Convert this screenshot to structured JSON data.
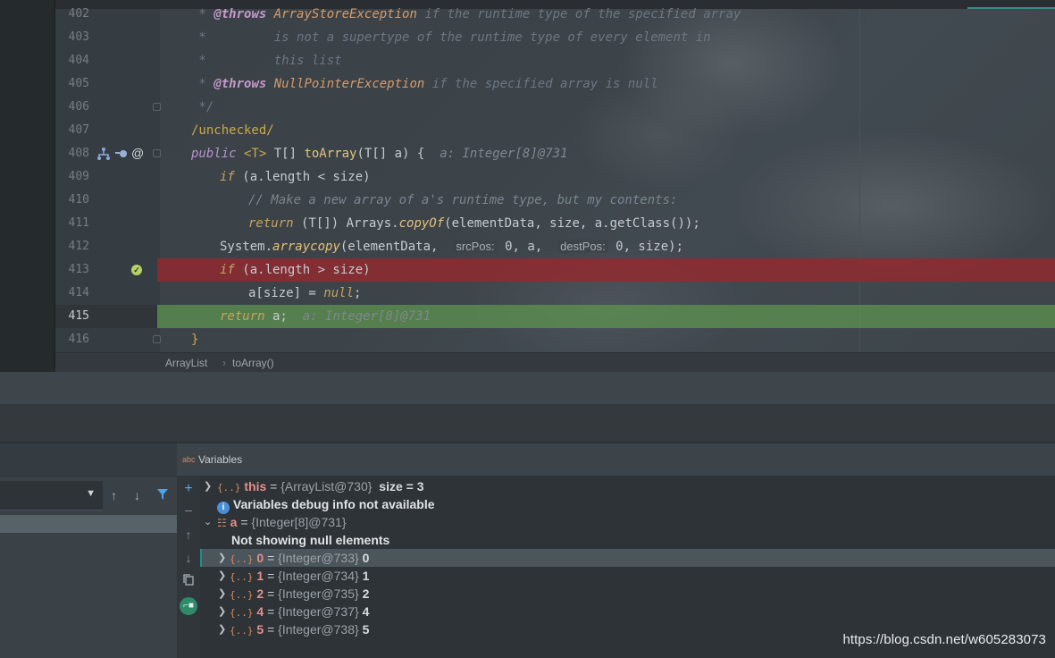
{
  "editor": {
    "lines": [
      {
        "num": "402"
      },
      {
        "num": "403"
      },
      {
        "num": "404"
      },
      {
        "num": "405"
      },
      {
        "num": "406"
      },
      {
        "num": "407"
      },
      {
        "num": "408"
      },
      {
        "num": "409"
      },
      {
        "num": "410"
      },
      {
        "num": "411"
      },
      {
        "num": "412"
      },
      {
        "num": "413"
      },
      {
        "num": "414"
      },
      {
        "num": "415"
      },
      {
        "num": "416"
      }
    ],
    "code": {
      "l402_star": " * ",
      "l402_tag": "@throws",
      "l402_exc": "ArrayStoreException",
      "l402_text": " if the runtime type of the specified array",
      "l403_text": " *         is not a supertype of the runtime type of every element in",
      "l404_text": " *         this list",
      "l405_star": " * ",
      "l405_tag": "@throws",
      "l405_exc": "NullPointerException",
      "l405_text": " if the specified array is null",
      "l406_text": " */",
      "l407_text": "/unchecked/",
      "l408_public": "public",
      "l408_generic": " <T> ",
      "l408_ret": "T[] ",
      "l408_fn": "toArray",
      "l408_sig": "(T[] a) {",
      "l408_hint": "a: Integer[8]@731",
      "l409_if": "if",
      "l409_rest": " (a.length < size)",
      "l410_cmt": "// Make a new array of a's runtime type, but my contents:",
      "l411_ret": "return",
      "l411_rest": " (T[]) Arrays.",
      "l411_fn": "copyOf",
      "l411_args": "(elementData, size, a.getClass());",
      "l412_a": "System.",
      "l412_fn": "arraycopy",
      "l412_b": "(elementData, ",
      "l412_hint1": "srcPos:",
      "l412_c": " 0, a, ",
      "l412_hint2": "destPos:",
      "l412_d": " 0, size);",
      "l413_if": "if",
      "l413_rest": " (a.length > size)",
      "l414_a": "a[size] = ",
      "l414_null": "null",
      "l414_b": ";",
      "l415_ret": "return",
      "l415_rest": " a;",
      "l415_hint": "a: Integer[8]@731",
      "l416_text": "}"
    },
    "gutter_icons": {
      "hierarchy": "⚙",
      "at": "@",
      "check": "✓"
    },
    "breadcrumb": {
      "class": "ArrayList",
      "sep": "›",
      "method": "toArray()"
    }
  },
  "debugger": {
    "variables_title": "Variables",
    "variables_icon": "abc",
    "tree": [
      {
        "name": "this",
        "value": "{ArrayList@730}",
        "extra": "size = 3"
      },
      {
        "message": "Variables debug info not available"
      },
      {
        "name": "a",
        "value": "{Integer[8]@731}"
      },
      {
        "message": "Not showing null elements"
      },
      {
        "name": "0",
        "value": "{Integer@733}",
        "extra": "0"
      },
      {
        "name": "1",
        "value": "{Integer@734}",
        "extra": "1"
      },
      {
        "name": "2",
        "value": "{Integer@735}",
        "extra": "2"
      },
      {
        "name": "4",
        "value": "{Integer@737}",
        "extra": "4"
      },
      {
        "name": "5",
        "value": "{Integer@738}",
        "extra": "5"
      }
    ],
    "eq": "="
  },
  "watermark": "https://blog.csdn.net/w605283073"
}
